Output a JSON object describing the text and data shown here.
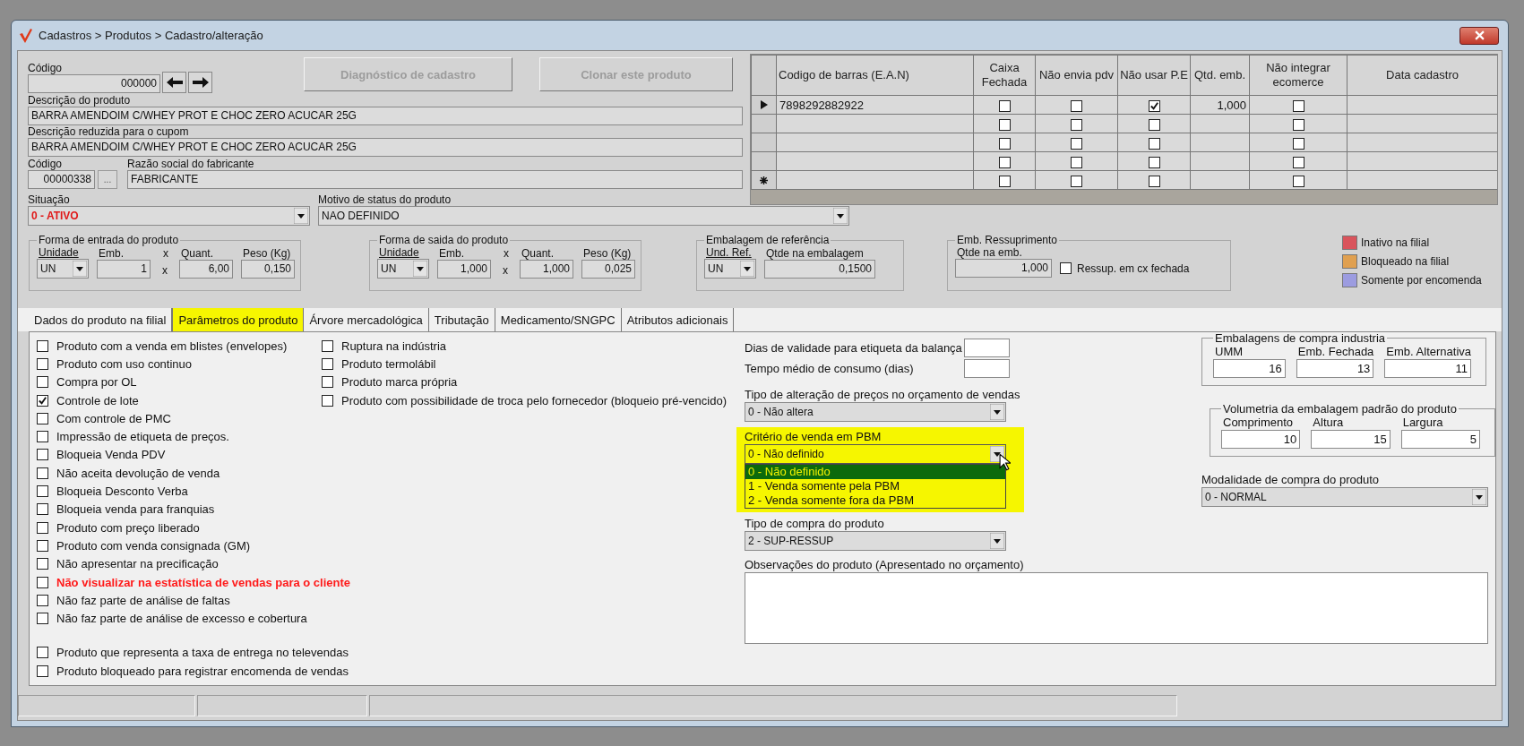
{
  "window": {
    "title": "Cadastros > Produtos > Cadastro/alteração"
  },
  "product": {
    "code": {
      "label": "Código",
      "value": "000000"
    },
    "actions": [
      {
        "label": "Diagnóstico de cadastro",
        "disabled": true
      },
      {
        "label": "Clonar este produto",
        "disabled": true
      }
    ],
    "description": {
      "label": "Descrição do produto",
      "value": "BARRA AMENDOIM C/WHEY PROT E CHOC ZERO ACUCAR 25G"
    },
    "short_description": {
      "label": "Descrição reduzida para o cupom",
      "value": "BARRA AMENDOIM C/WHEY PROT E CHOC ZERO ACUCAR 25G"
    },
    "manufacturer_code": {
      "label": "Código",
      "value": "00000338",
      "button": "..."
    },
    "manufacturer_name": {
      "label": "Razão social do fabricante",
      "value": "FABRICANTE"
    },
    "status": {
      "label": "Situação",
      "value": "0 - ATIVO"
    },
    "status_reason": {
      "label": "Motivo de status do produto",
      "value": "NAO DEFINIDO"
    }
  },
  "barcodes": {
    "columns": [
      "Codigo de barras (E.A.N)",
      "Caixa Fechada",
      "Não envia pdv",
      "Não usar P.E",
      "Qtd. emb.",
      "Não integrar ecomerce",
      "Data cadastro"
    ],
    "rows": [
      {
        "selected": true,
        "new_row": false,
        "ean": "7898292882922",
        "caixa_fechada": false,
        "nao_envia_pdv": false,
        "nao_usar_pe": true,
        "qtd_emb": "1,000",
        "nao_integrar_ecomerce": false
      },
      {
        "selected": false,
        "new_row": false,
        "caixa_fechada": false,
        "nao_envia_pdv": false,
        "nao_usar_pe": false,
        "nao_integrar_ecomerce": false
      },
      {
        "selected": false,
        "new_row": false,
        "caixa_fechada": false,
        "nao_envia_pdv": false,
        "nao_usar_pe": false,
        "nao_integrar_ecomerce": false
      },
      {
        "selected": false,
        "new_row": false,
        "caixa_fechada": false,
        "nao_envia_pdv": false,
        "nao_usar_pe": false,
        "nao_integrar_ecomerce": false
      },
      {
        "selected": false,
        "new_row": true,
        "caixa_fechada": false,
        "nao_envia_pdv": false,
        "nao_usar_pe": false,
        "nao_integrar_ecomerce": false
      }
    ]
  },
  "packaging_groups": [
    {
      "title": "Forma de entrada do produto",
      "fields": [
        {
          "kind": "select",
          "label": "Unidade",
          "value": "UN"
        },
        {
          "kind": "number",
          "label": "Emb.",
          "value": "1"
        },
        {
          "kind": "separator",
          "label": "x",
          "value": "x"
        },
        {
          "kind": "number",
          "label": "Quant.",
          "value": "6,00"
        },
        {
          "kind": "number",
          "label": "Peso (Kg)",
          "value": "0,150"
        }
      ]
    },
    {
      "title": "Forma de saida do produto",
      "fields": [
        {
          "kind": "select",
          "label": "Unidade",
          "value": "UN"
        },
        {
          "kind": "number",
          "label": "Emb.",
          "value": "1,000"
        },
        {
          "kind": "separator",
          "label": "x",
          "value": "x"
        },
        {
          "kind": "number",
          "label": "Quant.",
          "value": "1,000"
        },
        {
          "kind": "number",
          "label": "Peso (Kg)",
          "value": "0,025"
        }
      ]
    },
    {
      "title": "Embalagem de referência",
      "fields": [
        {
          "kind": "select",
          "label": "Und. Ref.",
          "value": "UN"
        },
        {
          "kind": "number",
          "label": "Qtde na embalagem",
          "value": "0,1500"
        }
      ]
    },
    {
      "title": "Emb. Ressuprimento",
      "fields": [
        {
          "kind": "number",
          "label": "Qtde na emb.",
          "value": "1,000"
        },
        {
          "kind": "checkbox",
          "label": "Ressup. em cx fechada",
          "checked": false
        }
      ]
    }
  ],
  "legend": [
    {
      "label": "Inativo na filial",
      "color": "#d9545c"
    },
    {
      "label": "Bloqueado na filial",
      "color": "#e0a050"
    },
    {
      "label": "Somente por encomenda",
      "color": "#9c9ce0"
    }
  ],
  "tabs": [
    {
      "label": "Dados do produto na filial",
      "selected": false
    },
    {
      "label": "Parâmetros do produto",
      "selected": true
    },
    {
      "label": "Árvore mercadológica",
      "selected": false
    },
    {
      "label": "Tributação",
      "selected": false
    },
    {
      "label": "Medicamento/SNGPC",
      "selected": false
    },
    {
      "label": "Atributos adicionais",
      "selected": false
    }
  ],
  "parameters": {
    "left_checks": [
      {
        "items": [
          {
            "label": "Produto com a venda em blistes (envelopes)",
            "checked": false,
            "kind": "normal"
          },
          {
            "label": "Produto com uso continuo",
            "checked": false,
            "kind": "normal"
          },
          {
            "label": "Compra por OL",
            "checked": false,
            "kind": "normal"
          },
          {
            "label": "Controle de lote",
            "checked": true,
            "kind": "normal"
          },
          {
            "label": "Com controle de PMC",
            "checked": false,
            "kind": "normal"
          },
          {
            "label": "Impressão de etiqueta de preços.",
            "checked": false,
            "kind": "normal"
          },
          {
            "label": "Bloqueia Venda PDV",
            "checked": false,
            "kind": "normal"
          },
          {
            "label": "Não aceita devolução de venda",
            "checked": false,
            "kind": "normal"
          },
          {
            "label": "Bloqueia Desconto Verba",
            "checked": false,
            "kind": "normal"
          },
          {
            "label": "Bloqueia venda para franquias",
            "checked": false,
            "kind": "normal"
          },
          {
            "label": "Produto com preço liberado",
            "checked": false,
            "kind": "normal"
          },
          {
            "label": "Produto com venda consignada (GM)",
            "checked": false,
            "kind": "normal"
          },
          {
            "label": "Não apresentar na precificação",
            "checked": false,
            "kind": "normal"
          },
          {
            "label": "Não visualizar na estatística de vendas para o cliente",
            "checked": false,
            "kind": "alert"
          },
          {
            "label": "Não faz parte de análise de faltas",
            "checked": false,
            "kind": "normal"
          },
          {
            "label": "Não faz parte de análise de excesso e cobertura",
            "checked": false,
            "kind": "normal"
          }
        ]
      },
      {
        "items": [
          {
            "label": "Produto que representa a taxa de entrega no televendas",
            "checked": false,
            "kind": "normal"
          },
          {
            "label": "Produto bloqueado para registrar encomenda de vendas",
            "checked": false,
            "kind": "normal"
          }
        ]
      }
    ],
    "right_checks": [
      {
        "label": "Ruptura na indústria",
        "checked": false
      },
      {
        "label": "Produto termolábil",
        "checked": false
      },
      {
        "label": "Produto marca própria",
        "checked": false
      },
      {
        "label": "Produto com possibilidade de troca pelo fornecedor (bloqueio pré-vencido)",
        "checked": false
      }
    ],
    "short_fields": [
      {
        "label": "Dias de validade para etiqueta da balança"
      },
      {
        "label": "Tempo médio de consumo (dias)"
      }
    ],
    "price_change": {
      "label": "Tipo de alteração de preços no orçamento de vendas",
      "value": "0 - Não altera"
    },
    "pbm": {
      "label": "Critério de venda em PBM",
      "value": "0 - Não definido",
      "highlighted": true,
      "expanded": true,
      "options": [
        {
          "label": "0 - Não definido",
          "selected": true
        },
        {
          "label": "1 - Venda somente pela PBM",
          "selected": false
        },
        {
          "label": "2 - Venda somente fora da PBM",
          "selected": false
        }
      ]
    },
    "purchase_type": {
      "label": "Tipo de compra do produto",
      "value": "2 - SUP-RESSUP"
    },
    "industry_packaging": {
      "title": "Embalagens de compra industria",
      "fields": [
        {
          "label": "UMM",
          "value": "16"
        },
        {
          "label": "Emb. Fechada",
          "value": "13"
        },
        {
          "label": "Emb. Alternativa",
          "value": "11"
        }
      ]
    },
    "volumetry": {
      "title": "Volumetria da embalagem padrão do produto",
      "fields": [
        {
          "label": "Comprimento",
          "value": "10"
        },
        {
          "label": "Altura",
          "value": "15"
        },
        {
          "label": "Largura",
          "value": "5"
        }
      ]
    },
    "purchase_mode": {
      "label": "Modalidade de compra do produto",
      "value": "0 - NORMAL"
    },
    "notes": {
      "label": "Observações do produto (Apresentado no orçamento)"
    }
  }
}
